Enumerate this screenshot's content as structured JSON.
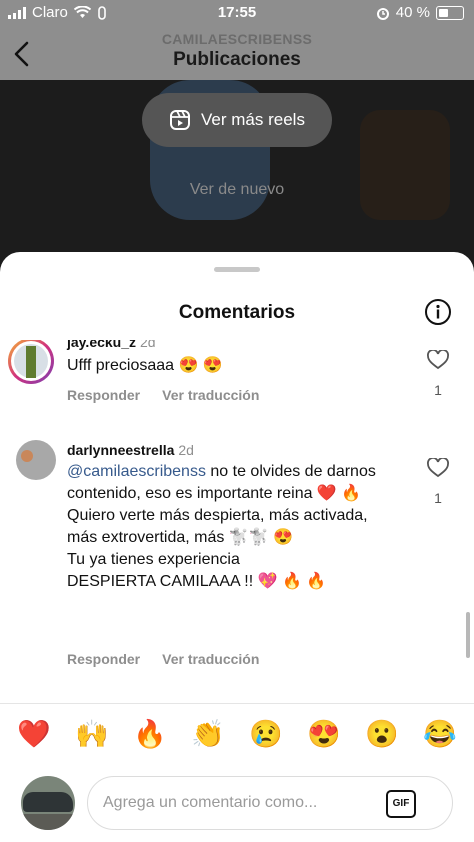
{
  "status_bar": {
    "carrier": "Claro",
    "time": "17:55",
    "battery": "40 %"
  },
  "header": {
    "username": "CAMILAESCRIBENSS",
    "title": "Publicaciones"
  },
  "video": {
    "reels_button": "Ver más reels",
    "replay_label": "Ver de nuevo"
  },
  "comments_sheet": {
    "title": "Comentarios",
    "comments": [
      {
        "username": "jay.ecku_z",
        "time": "2d",
        "text": "Ufff preciosaaa 😍 😍",
        "reply": "Responder",
        "translate": "Ver traducción",
        "likes": "1"
      },
      {
        "username": "darlynneestrella",
        "time": "2d",
        "mention": "@camilaescribenss",
        "lines": [
          " no te olvides de darnos contenido, eso es importante reina ❤️ 🔥",
          "Quiero verte más despierta, más activada, más extrovertida, más 🐩🐩 😍",
          "Tu ya tienes experiencia",
          "DESPIERTA CAMILAAA !! 💖 🔥 🔥"
        ],
        "reply": "Responder",
        "translate": "Ver traducción",
        "likes": "1"
      }
    ],
    "emoji_bar": [
      "❤️",
      "🙌",
      "🔥",
      "👏",
      "😢",
      "😍",
      "😮",
      "😂"
    ],
    "input": {
      "placeholder": "Agrega un comentario como...",
      "gif_label": "GIF"
    }
  }
}
